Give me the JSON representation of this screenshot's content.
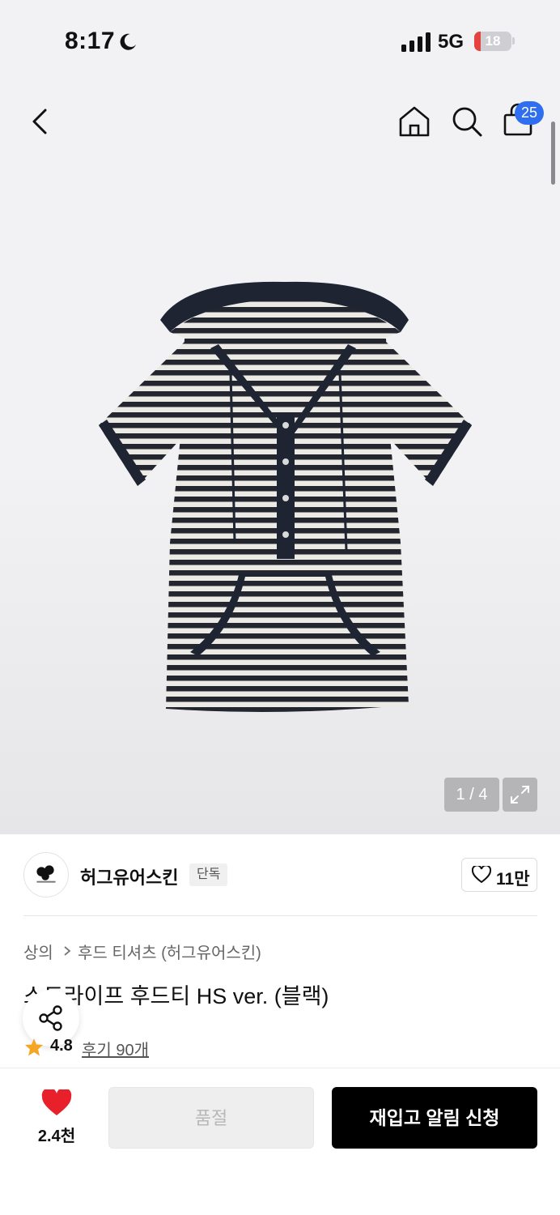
{
  "status_bar": {
    "time": "8:17",
    "network": "5G",
    "battery": "18",
    "battery_fraction": 0.18
  },
  "header": {
    "cart_count": "25",
    "icons": [
      "back-icon",
      "home-icon",
      "search-icon",
      "shopping-bag-icon"
    ]
  },
  "gallery": {
    "pager": "1 / 4",
    "expand_icon": "expand-icon"
  },
  "brand": {
    "name": "허그유어스킨",
    "exclusive_badge": "단독",
    "likes": "11만"
  },
  "breadcrumb": {
    "level1": "상의",
    "level2": "후드 티셔츠 (허그유어스킨)"
  },
  "product": {
    "title": "스트라이프 후드티 HS ver. (블랙)",
    "rating": "4.8",
    "reviews": "후기 90개"
  },
  "bottom_bar": {
    "wish_count": "2.4천",
    "soldout_label": "품절",
    "restock_label": "재입고 알림 신청"
  },
  "colors": {
    "accent_blue": "#2f6fef",
    "heart_red": "#e8202a",
    "star_orange": "#f5a623"
  }
}
